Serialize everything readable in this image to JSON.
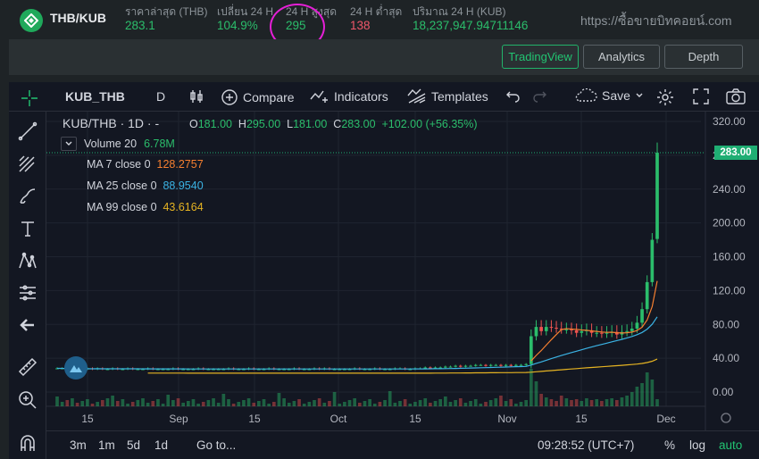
{
  "header": {
    "pair": "THB/KUB",
    "stats": [
      {
        "label": "ราคาล่าสุด (THB)",
        "value": "283.1",
        "color": "green"
      },
      {
        "label": "เปลี่ยน 24 H",
        "value": "104.9%",
        "color": "green"
      },
      {
        "label": "24 H สูงสุด",
        "value": "295",
        "color": "green"
      },
      {
        "label": "24 H ต่ำสุด",
        "value": "138",
        "color": "red"
      },
      {
        "label": "ปริมาณ 24 H (KUB)",
        "value": "18,237,947.94711146",
        "color": "green"
      }
    ],
    "watermark": "https://ซื้อขายบิทคอยน์.com"
  },
  "tabs": [
    "TradingView",
    "Analytics",
    "Depth"
  ],
  "toolbar": {
    "symbol": "KUB_THB",
    "interval": "D",
    "compare": "Compare",
    "indicators": "Indicators",
    "templates": "Templates",
    "save": "Save"
  },
  "legend": {
    "symbol": "KUB/THB",
    "interval": "1D",
    "dash": "-",
    "o_label": "O",
    "o": "181.00",
    "h_label": "H",
    "h": "295.00",
    "l_label": "L",
    "l": "181.00",
    "c_label": "C",
    "c": "283.00",
    "change": "+102.00 (+56.35%)",
    "volume_label": "Volume 20",
    "volume": "6.78M",
    "ma7_label": "MA 7 close 0",
    "ma7": "128.2757",
    "ma25_label": "MA 25 close 0",
    "ma25": "88.9540",
    "ma99_label": "MA 99 close 0",
    "ma99": "43.6164"
  },
  "price_axis": [
    "320.00",
    "280.00",
    "240.00",
    "200.00",
    "160.00",
    "120.00",
    "80.00",
    "40.00",
    "0.00"
  ],
  "last_price_tag": "283.00",
  "time_axis": [
    "15",
    "Sep",
    "15",
    "Oct",
    "15",
    "Nov",
    "15",
    "Dec"
  ],
  "bottom": {
    "ranges": [
      "3m",
      "1m",
      "5d",
      "1d"
    ],
    "goto": "Go to...",
    "clock": "09:28:52 (UTC+7)",
    "pct": "%",
    "log": "log",
    "auto": "auto"
  },
  "colors": {
    "up": "#26a69a",
    "down": "#ef5350",
    "ma7": "#f57f30",
    "ma25": "#3bb3e4",
    "ma99": "#e5b322",
    "accent": "#22b26a"
  },
  "chart_data": {
    "type": "candlestick",
    "ylim": [
      0,
      330
    ],
    "series_note_close": [
      28,
      28,
      27,
      28,
      27,
      27,
      28,
      27,
      28,
      27,
      27,
      28,
      27,
      27,
      28,
      27,
      27,
      27,
      28,
      27,
      27,
      27,
      27,
      28,
      27,
      27,
      27,
      27,
      28,
      27,
      27,
      27,
      27,
      27,
      28,
      27,
      27,
      27,
      28,
      27,
      27,
      27,
      28,
      27,
      27,
      27,
      27,
      28,
      27,
      27,
      27,
      28,
      27,
      28,
      27,
      27,
      27,
      27,
      27,
      28,
      27,
      27,
      27,
      28,
      27,
      27,
      27,
      28,
      28,
      27,
      27,
      28,
      28,
      29,
      28,
      29,
      29,
      30,
      30,
      31,
      30,
      31,
      31,
      32,
      32,
      31,
      32,
      32,
      31,
      32,
      31,
      32,
      32,
      33,
      66,
      77,
      72,
      77,
      76,
      75,
      74,
      74,
      73,
      70,
      72,
      73,
      70,
      70,
      69,
      70,
      71,
      68,
      71,
      72,
      75,
      82,
      98,
      130,
      180,
      283
    ]
  }
}
